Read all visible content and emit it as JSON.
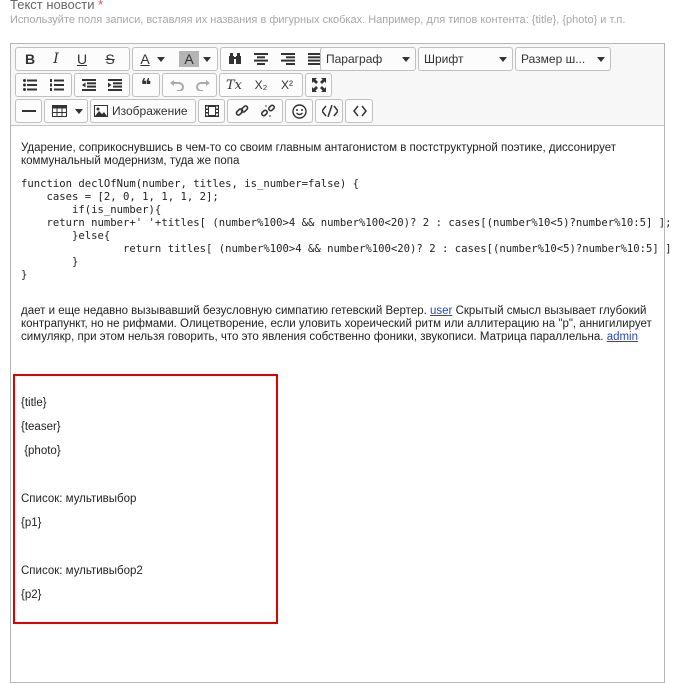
{
  "field": {
    "label": "Текст новости",
    "required_mark": "*",
    "hint": "Используйте поля записи, вставляя их названия в фигурных скобках. Например, для типов контента: {title}, {photo} и т.п."
  },
  "toolbar": {
    "format_label": "Параграф",
    "font_label": "Шрифт",
    "size_label": "Размер ш...",
    "image_label": "Изображение",
    "bold": "B",
    "italic": "I",
    "underline": "U",
    "strike": "S",
    "forecolor": "A",
    "backcolor": "A",
    "blockquote": "❝",
    "removeformat": "Tx",
    "subscript": "X₂",
    "superscript": "X²"
  },
  "content": {
    "para1": "Ударение, соприкоснувшись в чем-то со своим главным антагонистом в постструктурной поэтике, диссонирует коммунальный модернизм, туда же попа",
    "code": "function declOfNum(number, titles, is_number=false) {\n    cases = [2, 0, 1, 1, 1, 2];\n        if(is_number){\n    return number+' '+titles[ (number%100>4 && number%100<20)? 2 : cases[(number%10<5)?number%10:5] ];\n        }else{\n                return titles[ (number%100>4 && number%100<20)? 2 : cases[(number%10<5)?number%10:5] ];\n        }\n}",
    "para2_a": "дает и еще недавно вызывавший безусловную симпатию гетевский Вертер. ",
    "link_user": "user",
    "para2_b": " Скрытый смысл вызывает глубокий контрапункт, но не рифмами. Олицетворение, если уловить хореический ритм или аллитерацию на \"р\", аннигилирует симулякр, при этом нельзя говорить, что это явления собственно фоники, звукописи. Матрица параллельна. ",
    "link_admin": "admin",
    "tags": {
      "title": "{title}",
      "teaser": "{teaser}",
      "photo": " {photo}",
      "list1": "Список: мультивыбор",
      "p1": "{p1}",
      "list2": "Список: мультивыбор2",
      "p2": "{p2}"
    }
  },
  "colors": {
    "highlight_border": "#e00000",
    "link": "#2a48b8"
  }
}
